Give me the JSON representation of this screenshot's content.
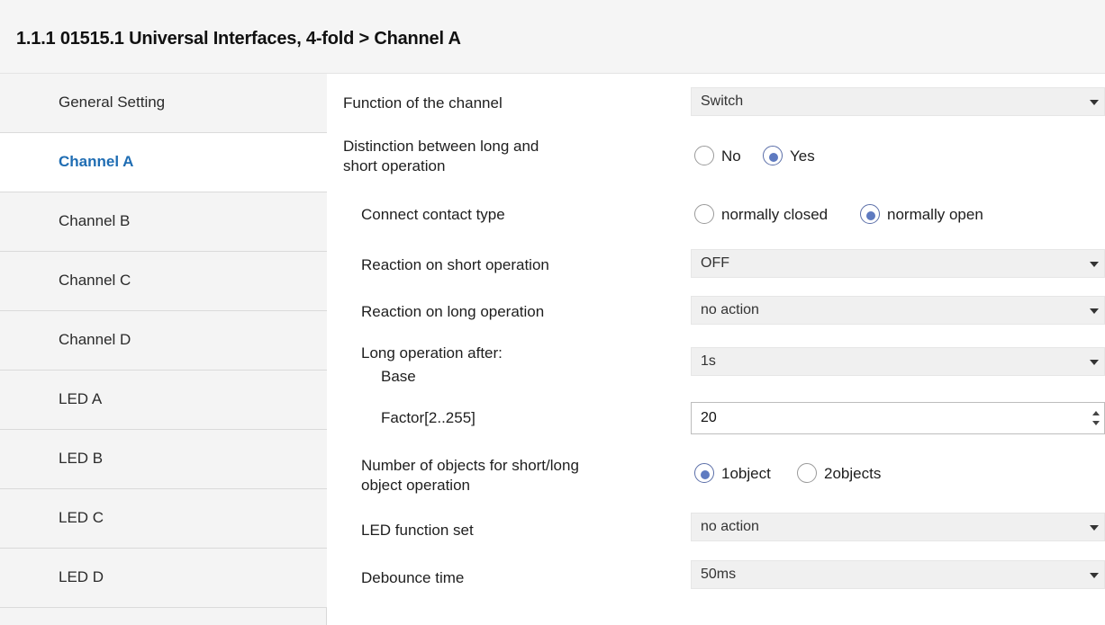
{
  "header": {
    "title": "1.1.1 01515.1 Universal Interfaces, 4-fold > Channel A"
  },
  "sidebar": {
    "items": [
      {
        "label": "General Setting",
        "active": false
      },
      {
        "label": "Channel A",
        "active": true
      },
      {
        "label": "Channel B",
        "active": false
      },
      {
        "label": "Channel C",
        "active": false
      },
      {
        "label": "Channel D",
        "active": false
      },
      {
        "label": "LED A",
        "active": false
      },
      {
        "label": "LED B",
        "active": false
      },
      {
        "label": "LED C",
        "active": false
      },
      {
        "label": "LED D",
        "active": false
      }
    ]
  },
  "params": {
    "function": {
      "label": "Function of the channel",
      "value": "Switch"
    },
    "distinction": {
      "label_line1": "Distinction between long and",
      "label_line2": "short operation",
      "options": [
        "No",
        "Yes"
      ],
      "selected": "Yes"
    },
    "contact_type": {
      "label": "Connect contact type",
      "options": [
        "normally closed",
        "normally open"
      ],
      "selected": "normally open"
    },
    "short_reaction": {
      "label": "Reaction on short operation",
      "value": "OFF"
    },
    "long_reaction": {
      "label": "Reaction on long operation",
      "value": "no action"
    },
    "long_base": {
      "label_line1": "Long operation after:",
      "label_line2": "Base",
      "value": "1s"
    },
    "factor": {
      "label": "Factor[2..255]",
      "value": "20"
    },
    "objects": {
      "label_line1": "Number of objects for short/long",
      "label_line2": "object operation",
      "options": [
        "1object",
        "2objects"
      ],
      "selected": "1object"
    },
    "led_function": {
      "label": "LED function set",
      "value": "no action"
    },
    "debounce": {
      "label": "Debounce time",
      "value": "50ms"
    }
  },
  "colors": {
    "accent": "#1f6db3",
    "radio": "#5e7ac0"
  }
}
